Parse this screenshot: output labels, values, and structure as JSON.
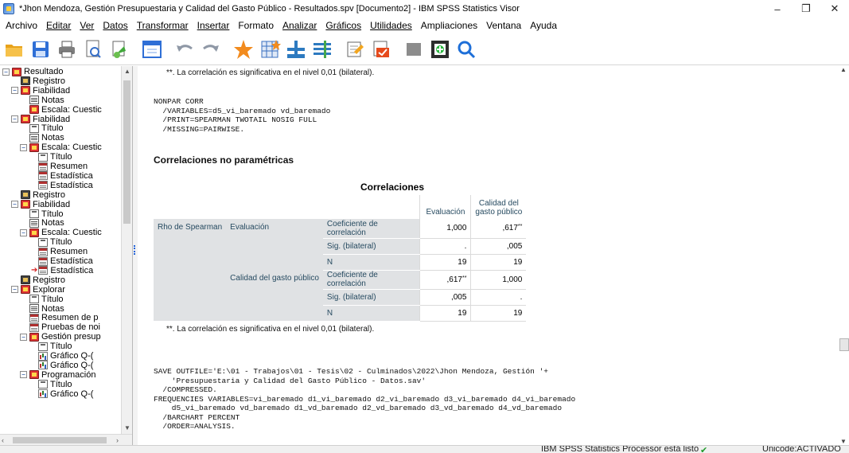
{
  "window": {
    "title": "*Jhon Mendoza, Gestión Presupuestaria y Calidad del Gasto Público - Resultados.spv [Documento2] - IBM SPSS Statistics Visor",
    "minimize": "–",
    "restore": "❐",
    "close": "✕"
  },
  "menu": [
    {
      "label": "Archivo"
    },
    {
      "label": "Editar"
    },
    {
      "label": "Ver"
    },
    {
      "label": "Datos"
    },
    {
      "label": "Transformar"
    },
    {
      "label": "Insertar"
    },
    {
      "label": "Formato"
    },
    {
      "label": "Analizar"
    },
    {
      "label": "Gráficos"
    },
    {
      "label": "Utilidades"
    },
    {
      "label": "Ampliaciones"
    },
    {
      "label": "Ventana"
    },
    {
      "label": "Ayuda"
    }
  ],
  "toolbar_icons": [
    "open-folder-icon",
    "save-icon",
    "print-icon",
    "print-preview-icon",
    "export-icon",
    "goto-data-icon",
    "undo-icon",
    "redo-icon",
    "goto-case-icon",
    "goto-variable-icon",
    "variables-icon",
    "output-designate-icon",
    "insert-output-icon",
    "select-last-output-icon",
    "hide-icon",
    "promote-icon",
    "search-icon"
  ],
  "tree": {
    "items": [
      {
        "label": "Resultado",
        "icon": "book",
        "level": 0,
        "toggle": "−"
      },
      {
        "label": "Registro",
        "icon": "log",
        "level": 1
      },
      {
        "label": "Fiabilidad",
        "icon": "book",
        "level": 1,
        "toggle": "−"
      },
      {
        "label": "Notas",
        "icon": "note",
        "level": 2
      },
      {
        "label": "Escala: Cuestic",
        "icon": "book",
        "level": 2
      },
      {
        "label": "Fiabilidad",
        "icon": "book",
        "level": 1,
        "toggle": "−"
      },
      {
        "label": "Título",
        "icon": "title",
        "level": 2
      },
      {
        "label": "Notas",
        "icon": "note",
        "level": 2
      },
      {
        "label": "Escala: Cuestic",
        "icon": "book",
        "level": 2,
        "toggle": "−"
      },
      {
        "label": "Título",
        "icon": "title",
        "level": 3
      },
      {
        "label": "Resumen",
        "icon": "table",
        "level": 3
      },
      {
        "label": "Estadística",
        "icon": "table",
        "level": 3
      },
      {
        "label": "Estadística",
        "icon": "table",
        "level": 3
      },
      {
        "label": "Registro",
        "icon": "log",
        "level": 1
      },
      {
        "label": "Fiabilidad",
        "icon": "book",
        "level": 1,
        "toggle": "−"
      },
      {
        "label": "Título",
        "icon": "title",
        "level": 2
      },
      {
        "label": "Notas",
        "icon": "note",
        "level": 2
      },
      {
        "label": "Escala: Cuestic",
        "icon": "book",
        "level": 2,
        "toggle": "−"
      },
      {
        "label": "Título",
        "icon": "title",
        "level": 3
      },
      {
        "label": "Resumen",
        "icon": "table",
        "level": 3
      },
      {
        "label": "Estadística",
        "icon": "table",
        "level": 3
      },
      {
        "label": "Estadística",
        "icon": "table",
        "level": 3,
        "arrow": "➔"
      },
      {
        "label": "Registro",
        "icon": "log",
        "level": 1
      },
      {
        "label": "Explorar",
        "icon": "book",
        "level": 1,
        "toggle": "−"
      },
      {
        "label": "Título",
        "icon": "title",
        "level": 2
      },
      {
        "label": "Notas",
        "icon": "note",
        "level": 2
      },
      {
        "label": "Resumen de p",
        "icon": "table",
        "level": 2
      },
      {
        "label": "Pruebas de noi",
        "icon": "table",
        "level": 2
      },
      {
        "label": "Gestión presup",
        "icon": "book",
        "level": 2,
        "toggle": "−"
      },
      {
        "label": "Título",
        "icon": "title",
        "level": 3
      },
      {
        "label": "Gráfico Q-(",
        "icon": "chart",
        "level": 3
      },
      {
        "label": "Gráfico Q-(",
        "icon": "chart",
        "level": 3
      },
      {
        "label": "Programación",
        "icon": "book",
        "level": 2,
        "toggle": "−"
      },
      {
        "label": "Título",
        "icon": "title",
        "level": 3
      },
      {
        "label": "Gráfico Q-(",
        "icon": "chart",
        "level": 3
      }
    ]
  },
  "content": {
    "footnote_top": "**. La correlación es significativa en el nivel 0,01 (bilateral).",
    "syntax_nonpar": "NONPAR CORR\n  /VARIABLES=d5_vi_baremado vd_baremado\n  /PRINT=SPEARMAN TWOTAIL NOSIG FULL\n  /MISSING=PAIRWISE.",
    "heading": "Correlaciones no paramétricas",
    "table_title": "Correlaciones",
    "table": {
      "col1": "Evaluación",
      "col2a": "Calidad del",
      "col2b": "gasto público",
      "rho": "Rho de Spearman",
      "rows": [
        {
          "var": "Evaluación",
          "stat_a": "Coeficiente de",
          "stat_b": "correlación",
          "v1": "1,000",
          "v2": ",617",
          "v2sup": "**"
        },
        {
          "stat_a": "Sig. (bilateral)",
          "v1": ".",
          "v2": ",005"
        },
        {
          "stat_a": "N",
          "v1": "19",
          "v2": "19"
        },
        {
          "var": "Calidad del gasto público",
          "stat_a": "Coeficiente de",
          "stat_b": "correlación",
          "v1": ",617",
          "v1sup": "**",
          "v2": "1,000"
        },
        {
          "stat_a": "Sig. (bilateral)",
          "v1": ",005",
          "v2": "."
        },
        {
          "stat_a": "N",
          "v1": "19",
          "v2": "19"
        }
      ]
    },
    "footnote_bottom": "**. La correlación es significativa en el nivel 0,01 (bilateral).",
    "syntax_save": "SAVE OUTFILE='E:\\01 - Trabajos\\01 - Tesis\\02 - Culminados\\2022\\Jhon Mendoza, Gestión '+\n    'Presupuestaria y Calidad del Gasto Público - Datos.sav'\n  /COMPRESSED.\nFREQUENCIES VARIABLES=vi_baremado d1_vi_baremado d2_vi_baremado d3_vi_baremado d4_vi_baremado\n    d5_vi_baremado vd_baremado d1_vd_baremado d2_vd_baremado d3_vd_baremado d4_vd_baremado\n  /BARCHART PERCENT\n  /ORDER=ANALYSIS."
  },
  "status": {
    "processor": "IBM SPSS Statistics Processor está listo",
    "unicode": "Unicode:ACTIVADO"
  }
}
